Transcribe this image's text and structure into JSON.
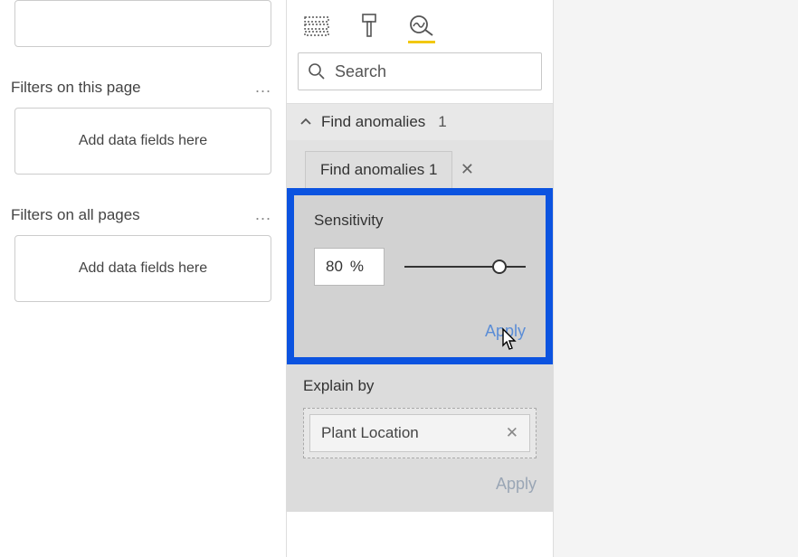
{
  "filters": {
    "page_section_label": "Filters on this page",
    "all_section_label": "Filters on all pages",
    "placeholder": "Add data fields here"
  },
  "viz": {
    "search_placeholder": "Search",
    "section": {
      "title": "Find anomalies",
      "count": "1"
    },
    "tab_chip": "Find anomalies 1",
    "sensitivity": {
      "label": "Sensitivity",
      "value": "80",
      "unit": "%"
    },
    "apply_label": "Apply",
    "explain": {
      "label": "Explain by",
      "field": "Plant Location",
      "apply_label": "Apply"
    }
  }
}
